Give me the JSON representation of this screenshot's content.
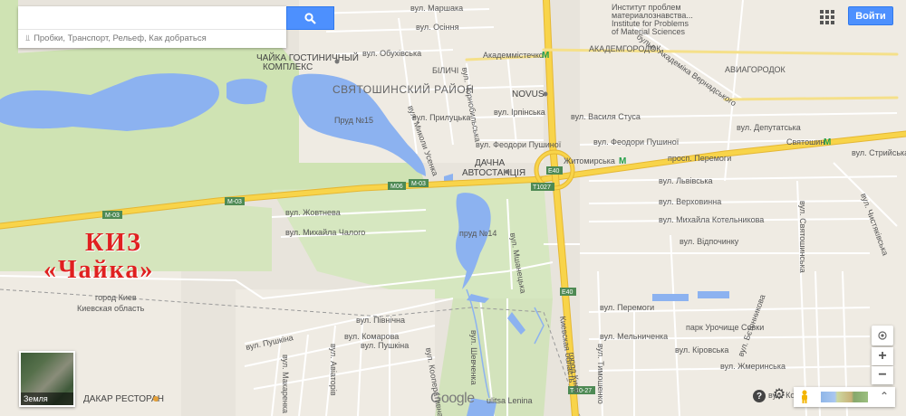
{
  "search": {
    "placeholder": "",
    "suggest_text": "Пробки, Транспорт, Рельеф, Как добраться"
  },
  "header": {
    "signin_label": "Войти"
  },
  "overlay": {
    "line1": "КИЗ",
    "line2": "«Чайка»"
  },
  "earth_tile": {
    "label": "Земля"
  },
  "google": {
    "logo": "Google"
  },
  "map": {
    "districts": {
      "sviatoshynskyi": "СВЯТОШИНСКИЙ РАЙОН",
      "akademgorodok": "АКАДЕМГОРОДОК",
      "aviagorodok": "АВИАГОРОДОК"
    },
    "places": {
      "chaika_hotel_1": "ЧАЙКА ГОСТИНИЧНЫЙ",
      "chaika_hotel_2": "КОМПЛЕКС",
      "bilychi": "БІЛИЧІ",
      "bus_station_1": "ДАЧНА",
      "bus_station_2": "АВТОСТАНЦІЯ",
      "novus": "NOVUS",
      "institute_1": "Институт проблем",
      "institute_2": "материалознавства...",
      "institute_3": "Institute for Problems",
      "institute_4": "of Material Sciences",
      "dakar": "ДАКАР РЕСТОРАН",
      "park": "парк Урочище Совки"
    },
    "water": {
      "pond15": "Пруд №15",
      "pond14": "пруд №14"
    },
    "metro": {
      "akademmistechko": "Академмістечко",
      "zhytomyrska": "Житомирська",
      "sviatoshyn": "Святошин"
    },
    "streets": {
      "marshaka": "вул. Маршака",
      "osinnia": "вул. Осіння",
      "obukhivska": "вул. Обухівська",
      "prylutska": "вул. Прилуцька",
      "chornobylska": "вул. Чорнобильська",
      "irpinska": "вул. Ірпінська",
      "pushynoi_1": "вул. Феодори Пушиної",
      "pushynoi_2": "вул. Феодори Пушиної",
      "stusa": "вул. Василя Стуса",
      "vernadskoho": "бульв. Академіка Вернадського",
      "deputatska": "вул. Депутатська",
      "peremohy": "просп. Перемоги",
      "lvivska": "вул. Львівська",
      "verkhovynna": "вул. Верховинна",
      "kotelnykova": "вул. Михайла Котельникова",
      "vidpochynku": "вул. Відпочинку",
      "zhovtneva": "вул. Жовтнева",
      "chaloho": "вул. Михайла Чалого",
      "svyatoshynska": "вул. Святошинська",
      "chystiakivska": "вул. Чистяківська",
      "stritska": "вул. Стрийська",
      "usenka": "вул. Миколи Усенка",
      "mshanetska": "вул. Мшанецька",
      "peremohy2": "вул. Перемоги",
      "melnychenka": "вул. Мельниченка",
      "kirovska": "вул. Кіровська",
      "betonnykova": "вул. Бєтонникова",
      "zhmerynska": "вул. Жмеринська",
      "pivnichna": "вул. Північна",
      "komarova": "вул. Комарова",
      "pushkina": "вул. Пушкіна",
      "pushkina2": "вул. Пушкіна",
      "lenina": "ulitsa Lenina",
      "kolasa": "вул. Коласа",
      "tymoshenka": "вул. Тимошенко",
      "koperativna": "вул. Кооперативна",
      "shevchenka": "вул. Шевченка",
      "avtorov": "вул. Авіаторів",
      "makarenka": "вул. Макаренка"
    },
    "boundary": {
      "kyiv": "город Киев",
      "oblast": "Киевская область",
      "kyiv_v": "город Киев",
      "oblast_v": "Киевская область"
    },
    "highways": {
      "m03_a": "М-03",
      "m03_b": "М-03",
      "m03_c": "М-03",
      "m06": "М06",
      "e40_a": "E40",
      "e40_b": "E40",
      "t1027_a": "T1027",
      "t1027_b": "T-10-27"
    }
  },
  "colors": {
    "road_major": "#f8d44a",
    "road_stroke": "#e5b733",
    "water": "#8cb2f0",
    "green": "#cfe3b3",
    "land": "#e8e4dc",
    "overlay_text": "#e02020",
    "button_blue": "#4d90fe"
  },
  "icons": [
    "search-icon",
    "route-icon",
    "apps-grid-icon",
    "help-icon",
    "settings-icon",
    "pegman-icon",
    "collapse-icon",
    "location-icon",
    "metro-icon"
  ]
}
